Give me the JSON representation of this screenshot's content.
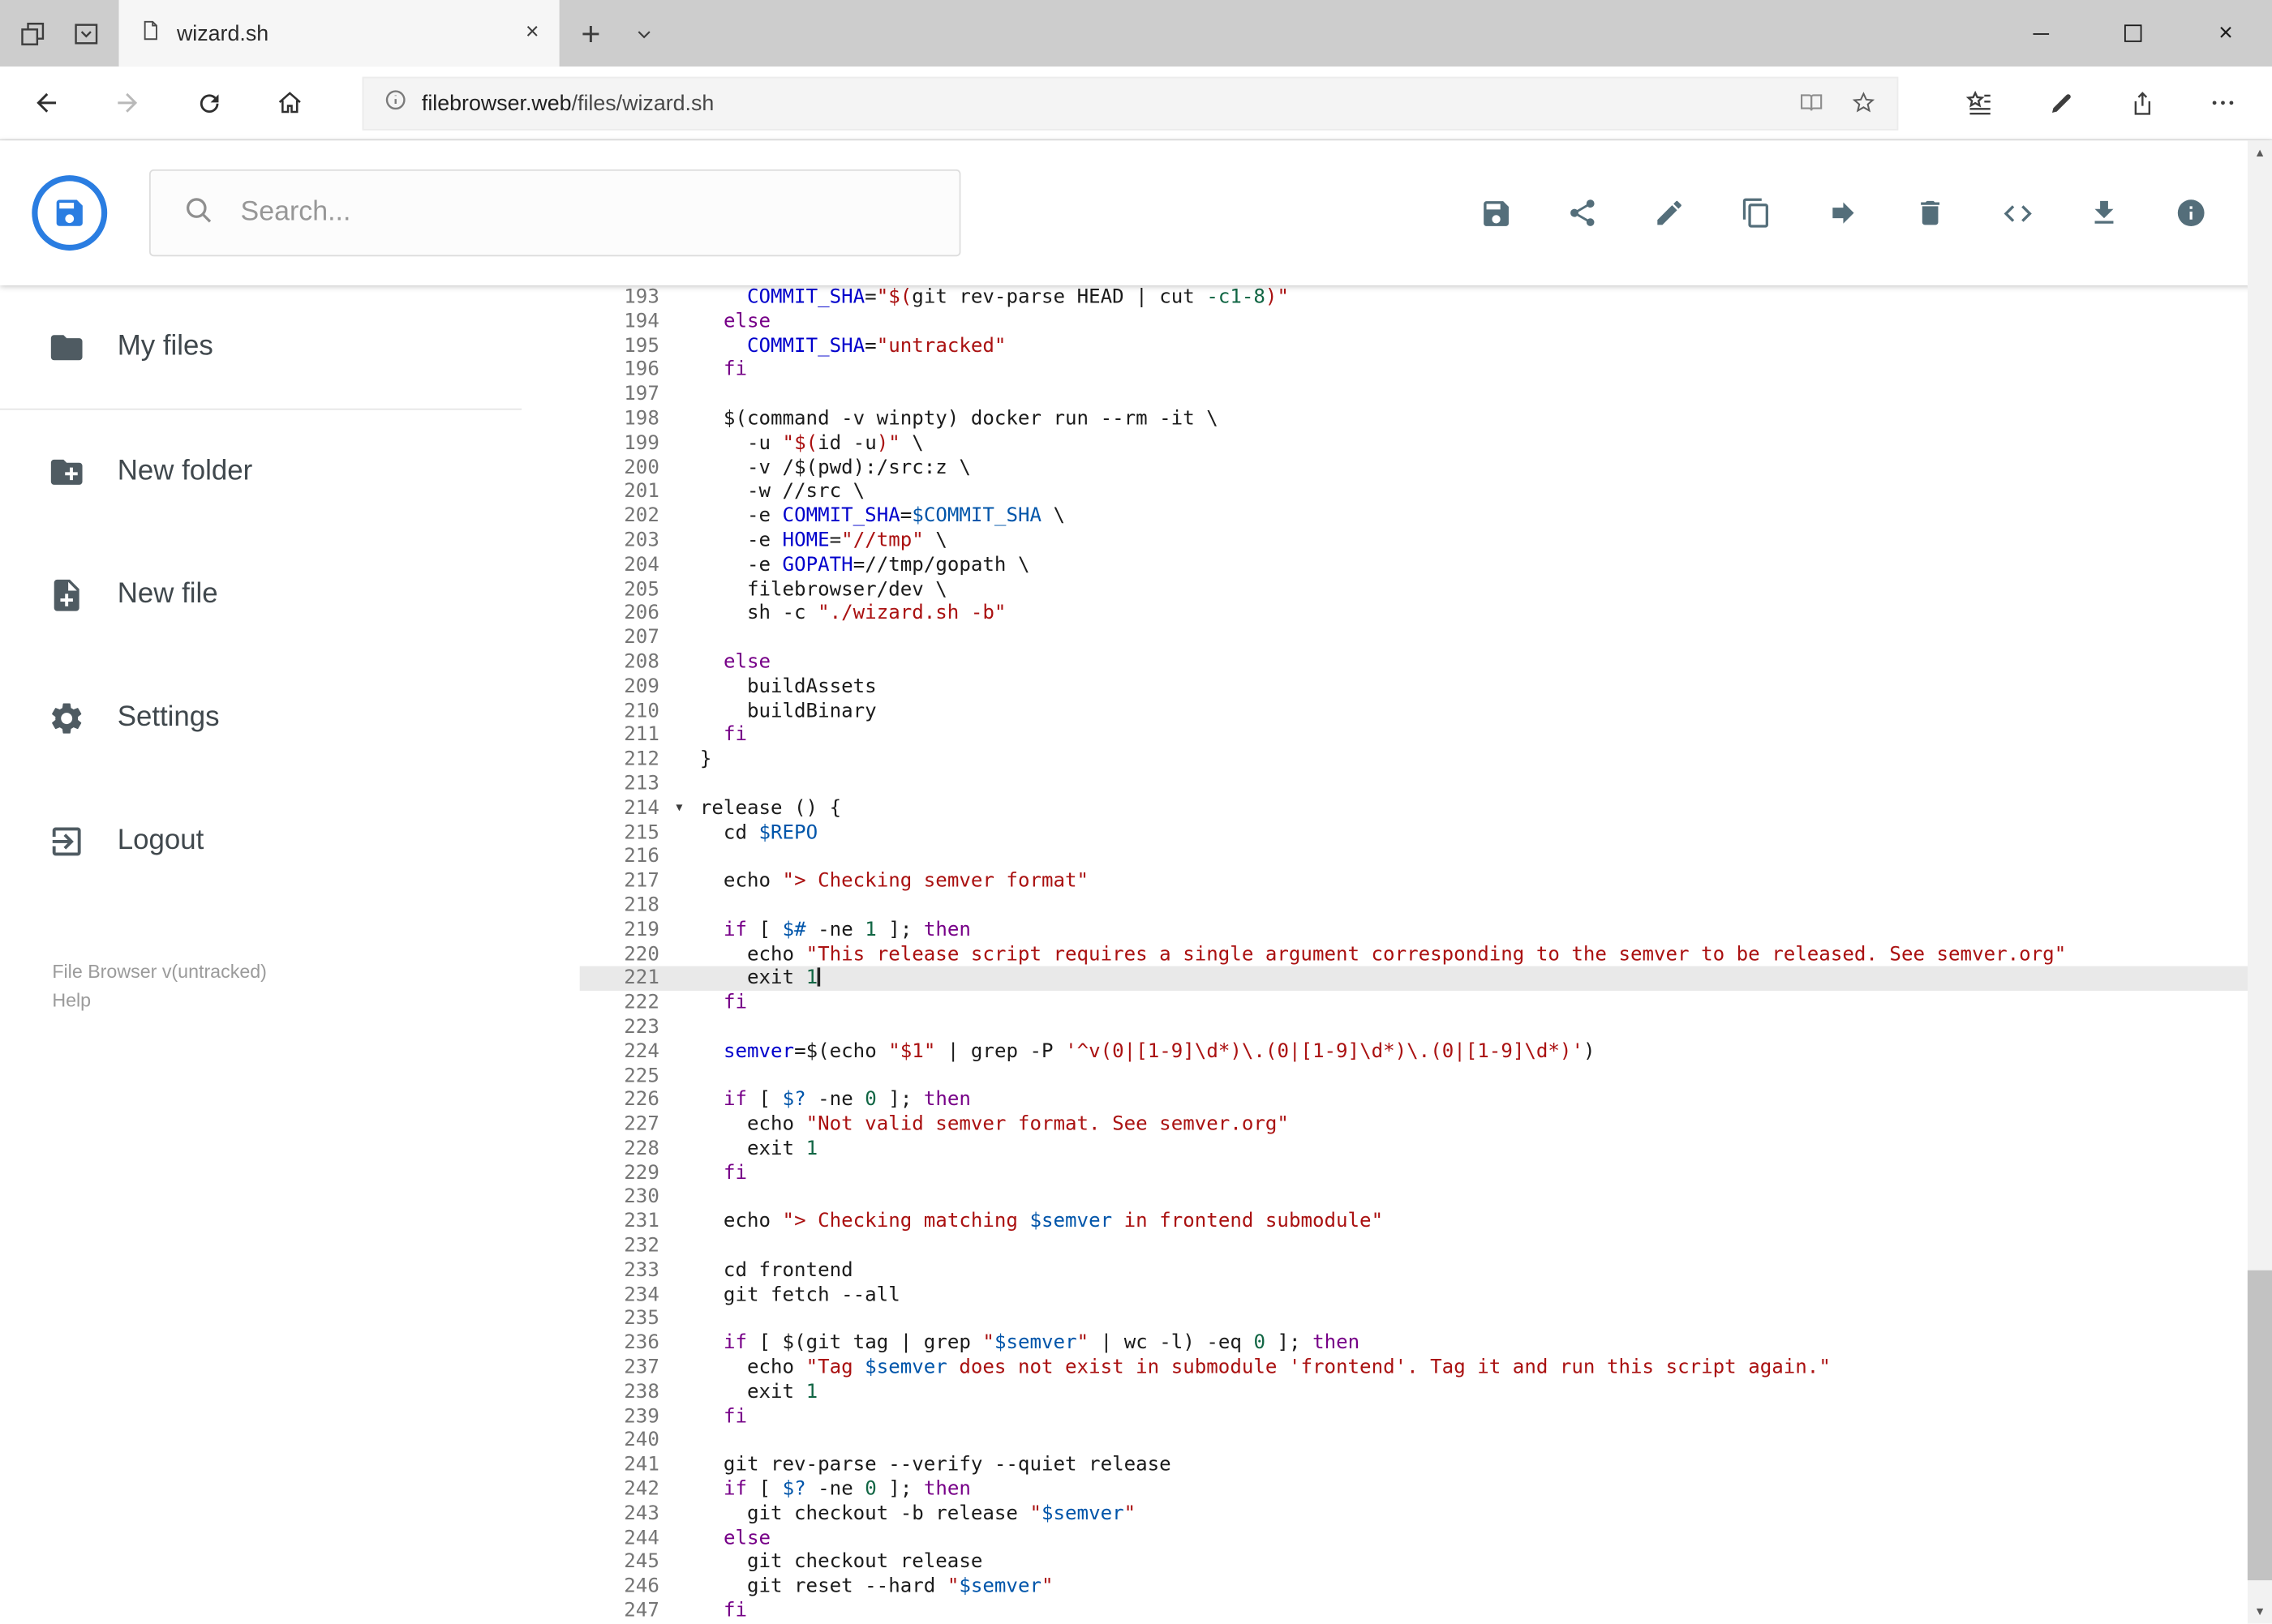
{
  "theme": {
    "tab_bar_bg": "#cdcdcd",
    "logo_blue": "#2a7de1",
    "toolbar_icon": "#546e7a",
    "sidebar_icon": "#4f5b62"
  },
  "icons": {
    "close_glyph": "×",
    "plus_glyph": "+",
    "scroll_up": "▲",
    "scroll_down": "▼",
    "fold_marker": "▾"
  },
  "browser": {
    "tab": {
      "title": "wizard.sh"
    },
    "url": {
      "domain": "filebrowser.web",
      "path": "/files/wizard.sh"
    }
  },
  "header": {
    "search_placeholder": "Search...",
    "toolbar_icon_names": [
      "save",
      "share",
      "edit",
      "copy",
      "move",
      "delete",
      "code",
      "download",
      "info"
    ]
  },
  "sidebar": {
    "items": [
      {
        "label": "My files",
        "icon": "folder-icon"
      },
      {
        "label": "New folder",
        "icon": "new-folder-icon"
      },
      {
        "label": "New file",
        "icon": "new-file-icon"
      },
      {
        "label": "Settings",
        "icon": "settings-icon"
      },
      {
        "label": "Logout",
        "icon": "logout-icon"
      }
    ],
    "footer": {
      "version": "File Browser v(untracked)",
      "help": "Help"
    }
  },
  "editor": {
    "colors": {
      "keyword": "#770088",
      "string": "#aa1111",
      "variable": "#0055aa",
      "def": "#0000cc",
      "number": "#116644",
      "text": "#1b1b1b",
      "line_number": "#757575",
      "active_line_bg": "#e9e9e9"
    },
    "active_line": 221,
    "cursor_line": 221,
    "fold_marker_line": 214,
    "lines": [
      {
        "n": 193,
        "t": [
          [
            "    ",
            ""
          ],
          [
            "COMMIT_SHA",
            "d"
          ],
          [
            "=",
            ""
          ],
          [
            "\"$(",
            "s"
          ],
          [
            "git rev-parse HEAD | cut ",
            ""
          ],
          [
            "-c1-8",
            "n"
          ],
          [
            ")\"",
            "s"
          ]
        ]
      },
      {
        "n": 194,
        "t": [
          [
            "  ",
            ""
          ],
          [
            "else",
            "k"
          ]
        ]
      },
      {
        "n": 195,
        "t": [
          [
            "    ",
            ""
          ],
          [
            "COMMIT_SHA",
            "d"
          ],
          [
            "=",
            ""
          ],
          [
            "\"untracked\"",
            "s"
          ]
        ]
      },
      {
        "n": 196,
        "t": [
          [
            "  ",
            ""
          ],
          [
            "fi",
            "k"
          ]
        ]
      },
      {
        "n": 197,
        "t": []
      },
      {
        "n": 198,
        "t": [
          [
            "  $(command -v winpty) docker run --rm -it \\",
            ""
          ]
        ]
      },
      {
        "n": 199,
        "t": [
          [
            "    -u ",
            ""
          ],
          [
            "\"$(",
            "s"
          ],
          [
            "id -u",
            ""
          ],
          [
            ")\"",
            "s"
          ],
          [
            " \\",
            ""
          ]
        ]
      },
      {
        "n": 200,
        "t": [
          [
            "    -v /$(pwd):/src:z \\",
            ""
          ]
        ]
      },
      {
        "n": 201,
        "t": [
          [
            "    -w //src \\",
            ""
          ]
        ]
      },
      {
        "n": 202,
        "t": [
          [
            "    -e ",
            ""
          ],
          [
            "COMMIT_SHA",
            "d"
          ],
          [
            "=",
            ""
          ],
          [
            "$COMMIT_SHA",
            "v"
          ],
          [
            " \\",
            ""
          ]
        ]
      },
      {
        "n": 203,
        "t": [
          [
            "    -e ",
            ""
          ],
          [
            "HOME",
            "d"
          ],
          [
            "=",
            ""
          ],
          [
            "\"//tmp\"",
            "s"
          ],
          [
            " \\",
            ""
          ]
        ]
      },
      {
        "n": 204,
        "t": [
          [
            "    -e ",
            ""
          ],
          [
            "GOPATH",
            "d"
          ],
          [
            "=//tmp/gopath \\",
            ""
          ]
        ]
      },
      {
        "n": 205,
        "t": [
          [
            "    filebrowser/dev \\",
            ""
          ]
        ]
      },
      {
        "n": 206,
        "t": [
          [
            "    sh -c ",
            ""
          ],
          [
            "\"./wizard.sh -b\"",
            "s"
          ]
        ]
      },
      {
        "n": 207,
        "t": []
      },
      {
        "n": 208,
        "t": [
          [
            "  ",
            ""
          ],
          [
            "else",
            "k"
          ]
        ]
      },
      {
        "n": 209,
        "t": [
          [
            "    buildAssets",
            ""
          ]
        ]
      },
      {
        "n": 210,
        "t": [
          [
            "    buildBinary",
            ""
          ]
        ]
      },
      {
        "n": 211,
        "t": [
          [
            "  ",
            ""
          ],
          [
            "fi",
            "k"
          ]
        ]
      },
      {
        "n": 212,
        "t": [
          [
            "}",
            ""
          ]
        ]
      },
      {
        "n": 213,
        "t": []
      },
      {
        "n": 214,
        "t": [
          [
            "release () {",
            ""
          ]
        ]
      },
      {
        "n": 215,
        "t": [
          [
            "  cd ",
            ""
          ],
          [
            "$REPO",
            "v"
          ]
        ]
      },
      {
        "n": 216,
        "t": []
      },
      {
        "n": 217,
        "t": [
          [
            "  echo ",
            ""
          ],
          [
            "\"> Checking semver format\"",
            "s"
          ]
        ]
      },
      {
        "n": 218,
        "t": []
      },
      {
        "n": 219,
        "t": [
          [
            "  ",
            ""
          ],
          [
            "if",
            "k"
          ],
          [
            " [ ",
            ""
          ],
          [
            "$#",
            "v"
          ],
          [
            " -ne ",
            ""
          ],
          [
            "1",
            "n"
          ],
          [
            " ]; ",
            ""
          ],
          [
            "then",
            "k"
          ]
        ]
      },
      {
        "n": 220,
        "t": [
          [
            "    echo ",
            ""
          ],
          [
            "\"This release script requires a single argument corresponding to the semver to be released. See semver.org\"",
            "s"
          ]
        ]
      },
      {
        "n": 221,
        "t": [
          [
            "    exit ",
            ""
          ],
          [
            "1",
            "n"
          ]
        ]
      },
      {
        "n": 222,
        "t": [
          [
            "  ",
            ""
          ],
          [
            "fi",
            "k"
          ]
        ]
      },
      {
        "n": 223,
        "t": []
      },
      {
        "n": 224,
        "t": [
          [
            "  ",
            ""
          ],
          [
            "semver",
            "d"
          ],
          [
            "=$(echo ",
            ""
          ],
          [
            "\"$1\"",
            "s"
          ],
          [
            " | grep -P ",
            ""
          ],
          [
            "'^v(0|[1-9]\\d*)\\.(0|[1-9]\\d*)\\.(0|[1-9]\\d*)'",
            "s"
          ],
          [
            ")",
            ""
          ]
        ]
      },
      {
        "n": 225,
        "t": []
      },
      {
        "n": 226,
        "t": [
          [
            "  ",
            ""
          ],
          [
            "if",
            "k"
          ],
          [
            " [ ",
            ""
          ],
          [
            "$?",
            "v"
          ],
          [
            " -ne ",
            ""
          ],
          [
            "0",
            "n"
          ],
          [
            " ]; ",
            ""
          ],
          [
            "then",
            "k"
          ]
        ]
      },
      {
        "n": 227,
        "t": [
          [
            "    echo ",
            ""
          ],
          [
            "\"Not valid semver format. See semver.org\"",
            "s"
          ]
        ]
      },
      {
        "n": 228,
        "t": [
          [
            "    exit ",
            ""
          ],
          [
            "1",
            "n"
          ]
        ]
      },
      {
        "n": 229,
        "t": [
          [
            "  ",
            ""
          ],
          [
            "fi",
            "k"
          ]
        ]
      },
      {
        "n": 230,
        "t": []
      },
      {
        "n": 231,
        "t": [
          [
            "  echo ",
            ""
          ],
          [
            "\"> Checking matching ",
            "s"
          ],
          [
            "$semver",
            "v"
          ],
          [
            " in frontend submodule\"",
            "s"
          ]
        ]
      },
      {
        "n": 232,
        "t": []
      },
      {
        "n": 233,
        "t": [
          [
            "  cd frontend",
            ""
          ]
        ]
      },
      {
        "n": 234,
        "t": [
          [
            "  git fetch --all",
            ""
          ]
        ]
      },
      {
        "n": 235,
        "t": []
      },
      {
        "n": 236,
        "t": [
          [
            "  ",
            ""
          ],
          [
            "if",
            "k"
          ],
          [
            " [ $(git tag | grep ",
            ""
          ],
          [
            "\"",
            "s"
          ],
          [
            "$semver",
            "v"
          ],
          [
            "\"",
            "s"
          ],
          [
            " | wc -l) -eq ",
            ""
          ],
          [
            "0",
            "n"
          ],
          [
            " ]; ",
            ""
          ],
          [
            "then",
            "k"
          ]
        ]
      },
      {
        "n": 237,
        "t": [
          [
            "    echo ",
            ""
          ],
          [
            "\"Tag ",
            "s"
          ],
          [
            "$semver",
            "v"
          ],
          [
            " does not exist in submodule 'frontend'. Tag it and run this script again.\"",
            "s"
          ]
        ]
      },
      {
        "n": 238,
        "t": [
          [
            "    exit ",
            ""
          ],
          [
            "1",
            "n"
          ]
        ]
      },
      {
        "n": 239,
        "t": [
          [
            "  ",
            ""
          ],
          [
            "fi",
            "k"
          ]
        ]
      },
      {
        "n": 240,
        "t": []
      },
      {
        "n": 241,
        "t": [
          [
            "  git rev-parse --verify --quiet release",
            ""
          ]
        ]
      },
      {
        "n": 242,
        "t": [
          [
            "  ",
            ""
          ],
          [
            "if",
            "k"
          ],
          [
            " [ ",
            ""
          ],
          [
            "$?",
            "v"
          ],
          [
            " -ne ",
            ""
          ],
          [
            "0",
            "n"
          ],
          [
            " ]; ",
            ""
          ],
          [
            "then",
            "k"
          ]
        ]
      },
      {
        "n": 243,
        "t": [
          [
            "    git checkout -b release ",
            ""
          ],
          [
            "\"",
            "s"
          ],
          [
            "$semver",
            "v"
          ],
          [
            "\"",
            "s"
          ]
        ]
      },
      {
        "n": 244,
        "t": [
          [
            "  ",
            ""
          ],
          [
            "else",
            "k"
          ]
        ]
      },
      {
        "n": 245,
        "t": [
          [
            "    git checkout release",
            ""
          ]
        ]
      },
      {
        "n": 246,
        "t": [
          [
            "    git reset --hard ",
            ""
          ],
          [
            "\"",
            "s"
          ],
          [
            "$semver",
            "v"
          ],
          [
            "\"",
            "s"
          ]
        ]
      },
      {
        "n": 247,
        "t": [
          [
            "  ",
            ""
          ],
          [
            "fi",
            "k"
          ]
        ]
      }
    ]
  }
}
